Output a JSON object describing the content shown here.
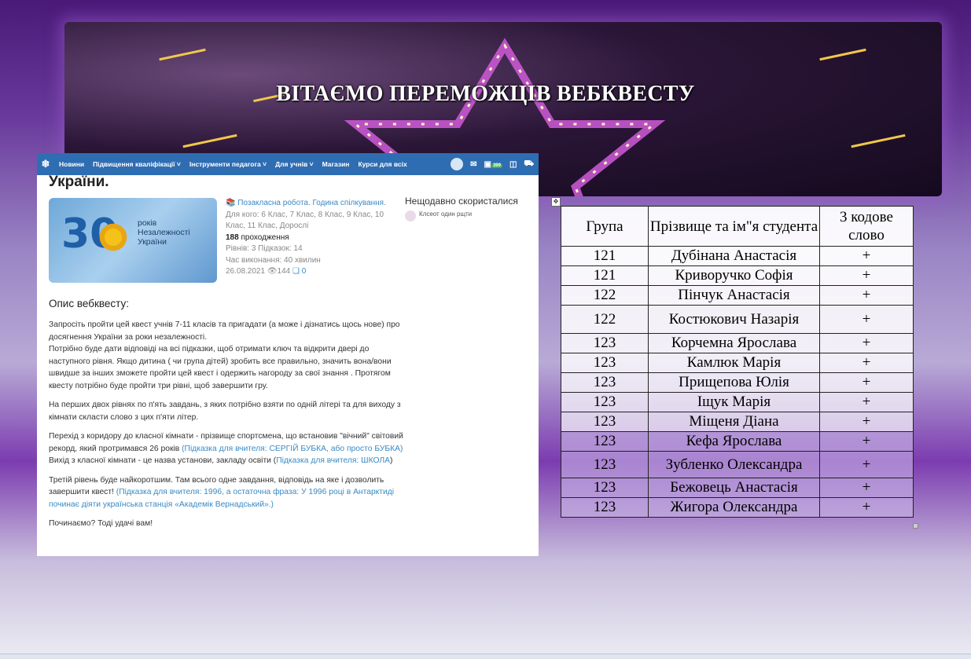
{
  "banner": {
    "title": "ВІТАЄМО ПЕРЕМОЖЦІВ ВЕБКВЕСТУ"
  },
  "screenshot": {
    "navbar": {
      "items": [
        "Новини",
        "Підвищення кваліфікації ˅",
        "Інструменти педагога ˅",
        "Для учнів ˅",
        "Магазин",
        "Курси для всіх"
      ],
      "notification_count": "399"
    },
    "heading": "України.",
    "thumbnail": {
      "number": "30",
      "caption_line1": "років",
      "caption_line2": "Незалежності",
      "caption_line3": "України"
    },
    "meta": {
      "category": "Позакласна робота. Година спілкування.",
      "for_whom_label": "Для кого:",
      "for_whom_value": "6 Клас, 7 Клас, 8 Клас, 9 Клас, 10 Клас, 11 Клас, Дорослі",
      "passes_count": "188",
      "passes_label": "проходження",
      "levels": "Рівнів: 3  Підказок: 14",
      "duration": "Час виконання: 40 хвилин",
      "date": "26.08.2021",
      "views": "144",
      "comments": "0"
    },
    "recent": {
      "title": "Нещодавно скористалися",
      "user": "Клсеот один рщти"
    },
    "description": {
      "title": "Опис вебквесту:",
      "p1": "Запросіть пройти цей квест учнів 7-11 класів та пригадати (а може і дізнатись щось нове) про досягнення України за роки незалежності.",
      "p1b": "Потрібно буде дати відповіді на всі підказки, щоб отримати ключ та відкрити двері до наступного рівня. Якщо дитина ( чи група дітей) зробить все правильно, значить вона/вони швидше за інших зможете пройти цей квест і одержить нагороду за свої знання . Протягом квесту потрібно буде пройти три рівні, щоб завершити гру.",
      "p2": "На перших двох рівнях по п'ять завдань, з яких потрібно взяти по одній літері та для виходу з кімнати скласти слово з цих п'яти літер.",
      "p3a": "Перехід з коридору до класної кімнати - прізвище спортсмена, що встановив \"вічний\" світовий рекорд, який протримався 26 років ",
      "p3hint1": "(Підказка для вчителя: СЕРГІЙ БУБКА, або просто БУБКА)",
      "p3b": " Вихід з класної кімнати - це назва установи, закладу освіти (",
      "p3hint2": "Підказка для вчителя: ШКОЛА",
      "p3c": ")",
      "p4a": "Третій рівень буде найкоротшим. Там всього одне завдання, відповідь на яке і дозволить завершити квест! ",
      "p4hint": "(Підказка для вчителя: 1996, а остаточна фраза: У 1996 році в Антарктиді починає діяти українська станція «Академік Вернадський».)",
      "p5": "Починаємо? Тоді удачі вам!"
    }
  },
  "table": {
    "headers": [
      "Група",
      "Прізвище та ім\"я студента",
      "3 кодове слово"
    ],
    "rows": [
      [
        "121",
        "Дубінана Анастасія",
        "+"
      ],
      [
        "121",
        "Криворучко Софія",
        "+"
      ],
      [
        "122",
        "Пінчук Анастасія",
        "+"
      ],
      [
        "122",
        "Костюкович Назарія",
        "+"
      ],
      [
        "123",
        "Корчемна Ярослава",
        "+"
      ],
      [
        "123",
        "Камлюк Марія",
        "+"
      ],
      [
        "123",
        "Прищепова Юлія",
        "+"
      ],
      [
        "123",
        "Іщук Марія",
        "+"
      ],
      [
        "123",
        "Міщеня Діана",
        "+"
      ],
      [
        "123",
        "Кефа Ярослава",
        "+"
      ],
      [
        "123",
        "Зубленко Олександра",
        "+"
      ],
      [
        "123",
        "Бежовець Анастасія",
        "+"
      ],
      [
        "123",
        "Жигора Олександра",
        "+"
      ]
    ]
  }
}
